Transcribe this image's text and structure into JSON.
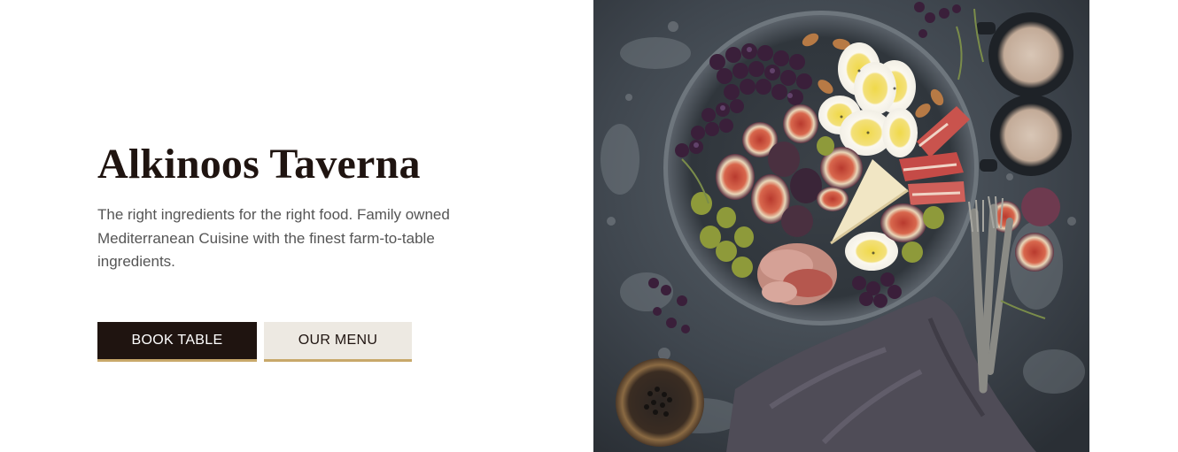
{
  "hero": {
    "title": "Alkinoos Taverna",
    "tagline": "The right ingredients for the right food. Family owned Mediterranean Cuisine with the finest farm-to-table ingredients."
  },
  "buttons": {
    "book_table": "BOOK TABLE",
    "our_menu": "OUR MENU"
  },
  "colors": {
    "dark": "#1f1410",
    "accent": "#c8a86a",
    "secondary_bg": "#ede9e2",
    "body_text": "#555555"
  }
}
